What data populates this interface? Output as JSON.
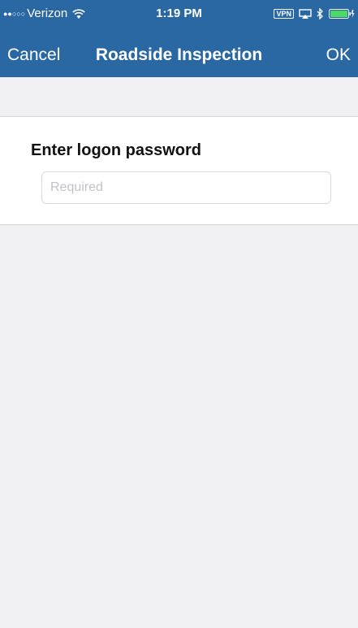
{
  "status_bar": {
    "carrier": "Verizon",
    "time": "1:19 PM",
    "vpn_label": "VPN",
    "icons": [
      "signal-dots-icon",
      "wifi-icon",
      "airplay-icon",
      "bluetooth-icon",
      "battery-icon",
      "charging-icon"
    ]
  },
  "nav": {
    "cancel_label": "Cancel",
    "title": "Roadside Inspection",
    "ok_label": "OK"
  },
  "form": {
    "password_label": "Enter logon password",
    "password_placeholder": "Required",
    "password_value": ""
  },
  "colors": {
    "nav_background": "#2a68a4",
    "page_background": "#efeff4",
    "card_background": "#ffffff"
  }
}
